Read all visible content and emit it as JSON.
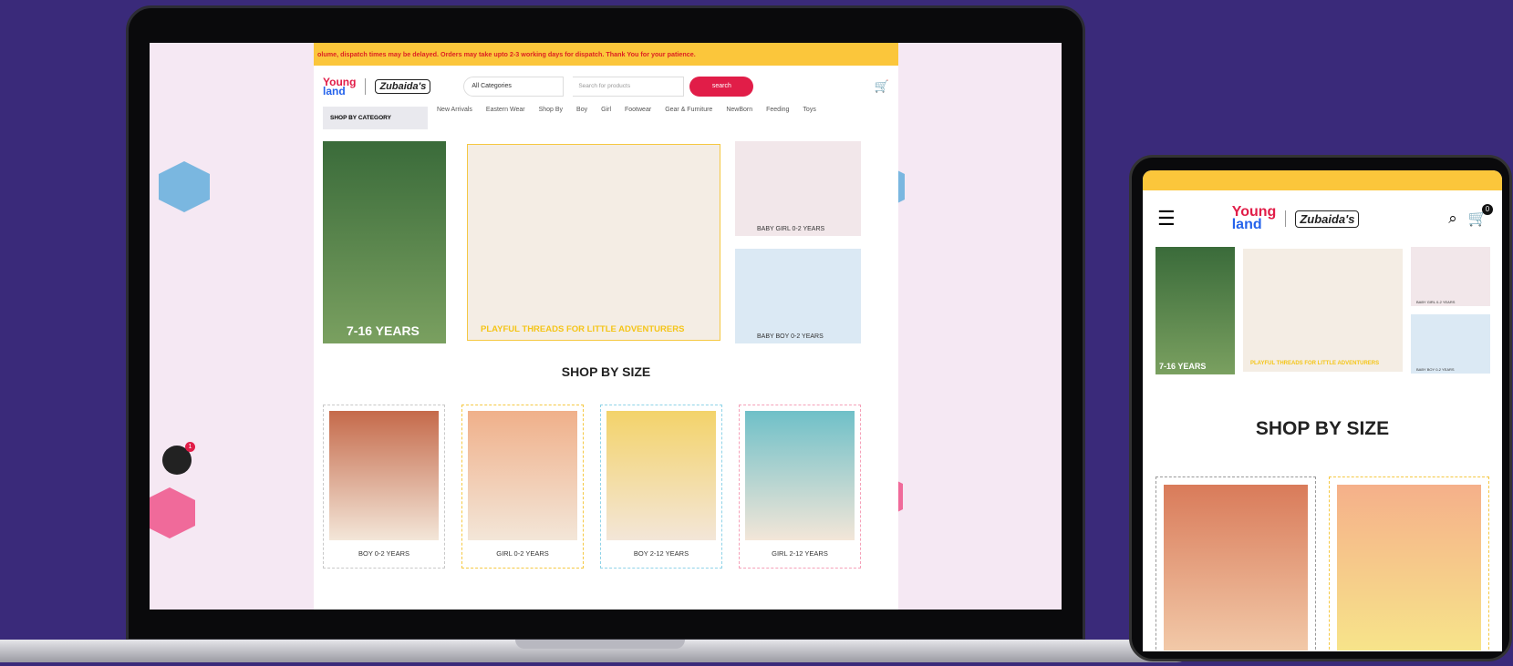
{
  "desktop": {
    "banner": "olume, dispatch times may be delayed. Orders may take upto 2-3 working days for dispatch. Thank You for your patience.",
    "logo_young": "Young",
    "logo_land": "land",
    "logo_zubaida": "Zubaida's",
    "category_select": "All Categories",
    "search_placeholder": "Search for products",
    "search_button": "search",
    "shop_by_category": "SHOP BY CATEGORY",
    "nav": [
      "New Arrivals",
      "Eastern Wear",
      "Shop By",
      "Boy",
      "Girl",
      "Footwear",
      "Gear & Furniture",
      "NewBorn",
      "Feeding",
      "Toys"
    ],
    "hero_left_label": "7-16 YEARS",
    "hero_center_label": "PLAYFUL THREADS FOR LITTLE ADVENTURERS",
    "hero_right_top_label": "BABY GIRL 0-2 YEARS",
    "hero_right_bottom_label": "BABY BOY 0-2 YEARS",
    "section_title": "SHOP BY SIZE",
    "sizes": [
      "BOY 0-2 YEARS",
      "GIRL 0-2 YEARS",
      "BOY 2-12 YEARS",
      "GIRL 2-12 YEARS"
    ],
    "chat_badge": "1"
  },
  "mobile": {
    "cart_count": "0",
    "hero_left_label": "7-16 YEARS",
    "hero_center_label": "PLAYFUL THREADS FOR LITTLE ADVENTURERS",
    "hero_right_top_label": "BABY GIRL 0-2 YEARS",
    "hero_right_bottom_label": "BABY BOY 0-2 YEARS",
    "section_title": "SHOP BY SIZE"
  },
  "colors": {
    "background": "#3a2a7a",
    "accent": "#e11d48",
    "banner": "#fbc63b"
  }
}
